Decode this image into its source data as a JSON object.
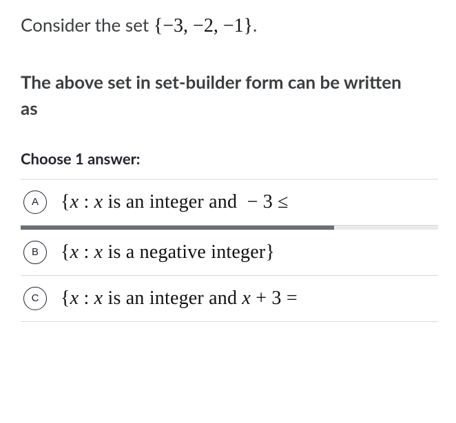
{
  "prompt": {
    "lead": "Consider the set ",
    "set_expr": "{−3, −2, −1}",
    "period": "."
  },
  "question": "The above set in set-builder form can be written as",
  "choose_label": "Choose 1 answer:",
  "options": [
    {
      "letter": "A",
      "math": "{x : x is an integer and  − 3 ≤ "
    },
    {
      "letter": "B",
      "math": "{x : x is a negative integer}"
    },
    {
      "letter": "C",
      "math": "{x : x is an integer and x + 3 ="
    }
  ],
  "progress_percent": 75
}
